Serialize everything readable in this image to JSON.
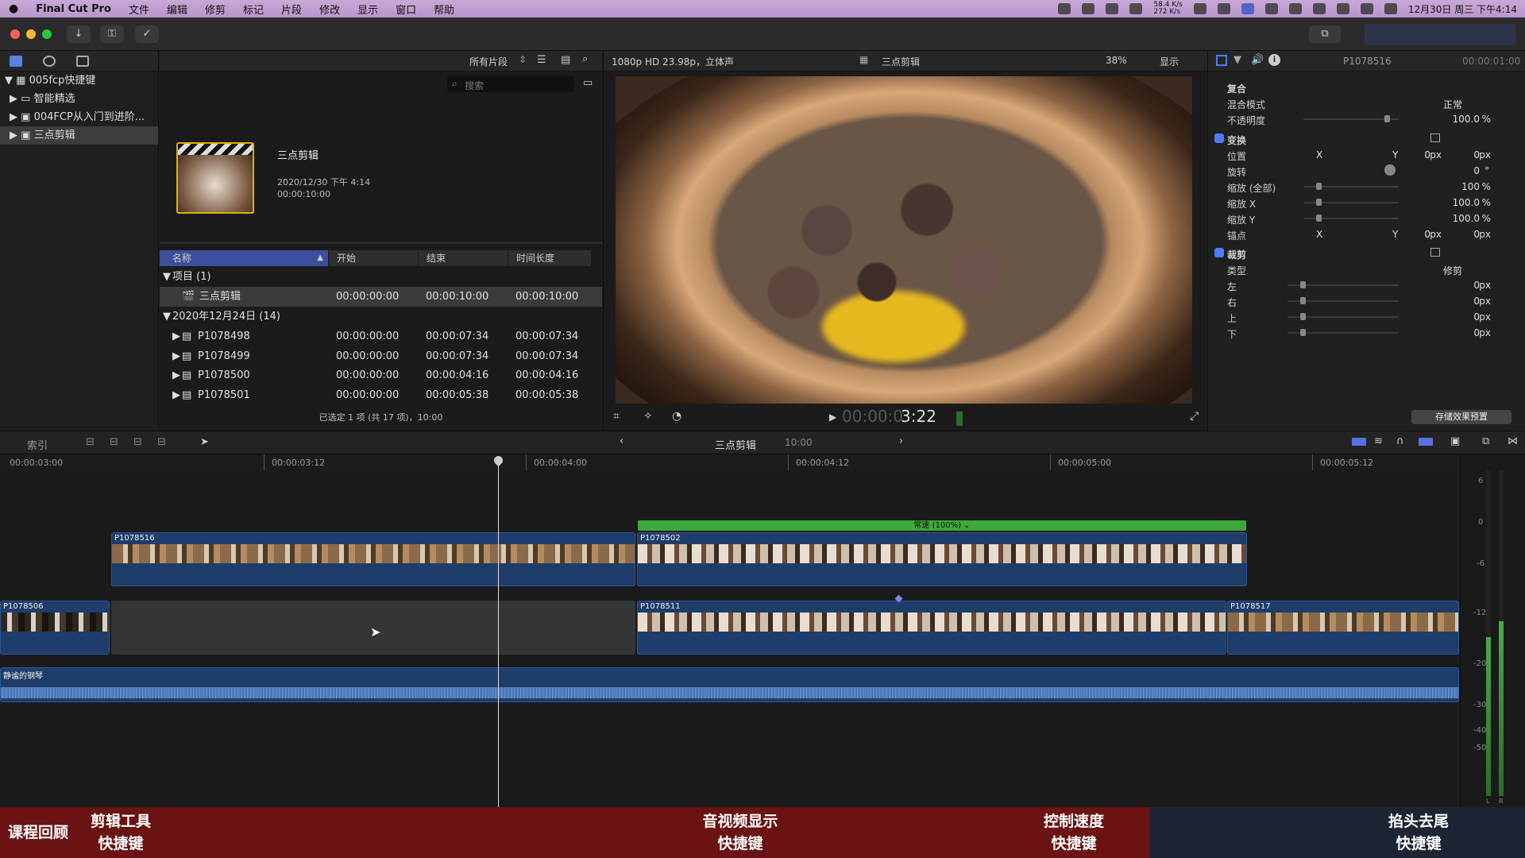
{
  "menubar": {
    "apple": "",
    "app_name": "Final Cut Pro",
    "items": [
      "文件",
      "编辑",
      "修剪",
      "标记",
      "片段",
      "修改",
      "显示",
      "窗口",
      "帮助"
    ],
    "net_up": "58.4 K/s",
    "net_down": "272 K/s",
    "clock": "12月30日 周三 下午4:14"
  },
  "library": {
    "rows": [
      {
        "label": "005fcp快捷键",
        "level": 0,
        "arrow": "▼",
        "selected": false
      },
      {
        "label": "智能精选",
        "level": 1,
        "arrow": "▶",
        "selected": false
      },
      {
        "label": "004FCP从入门到进阶...",
        "level": 1,
        "arrow": "▶",
        "selected": false
      },
      {
        "label": "三点剪辑",
        "level": 1,
        "arrow": "▶",
        "selected": true
      }
    ]
  },
  "browser": {
    "filter": "所有片段",
    "search_placeholder": "搜索",
    "project": {
      "title": "三点剪辑",
      "date": "2020/12/30 下午 4:14",
      "duration": "00:00:10:00"
    },
    "columns": [
      "名称",
      "开始",
      "结束",
      "时间长度"
    ],
    "group1": "项目 (1)",
    "project_row": {
      "name": "三点剪辑",
      "start": "00:00:00:00",
      "end": "00:00:10:00",
      "dur": "00:00:10:00"
    },
    "group2": "2020年12月24日 (14)",
    "clips": [
      {
        "name": "P1078498",
        "start": "00:00:00:00",
        "end": "00:00:07:34",
        "dur": "00:00:07:34"
      },
      {
        "name": "P1078499",
        "start": "00:00:00:00",
        "end": "00:00:07:34",
        "dur": "00:00:07:34"
      },
      {
        "name": "P1078500",
        "start": "00:00:00:00",
        "end": "00:00:04:16",
        "dur": "00:00:04:16"
      },
      {
        "name": "P1078501",
        "start": "00:00:00:00",
        "end": "00:00:05:38",
        "dur": "00:00:05:38"
      }
    ],
    "status": "已选定 1 项 (共 17 项)，10:00"
  },
  "viewer": {
    "format": "1080p HD 23.98p，立体声",
    "title": "三点剪辑",
    "zoom": "38%",
    "display": "显示",
    "timecode_dim": "00:00:0",
    "timecode": "3:22"
  },
  "inspector": {
    "clip_name": "P1078516",
    "clip_time": "00:00:01:00",
    "composite": "复合",
    "blend_label": "混合模式",
    "blend_value": "正常",
    "opacity_label": "不透明度",
    "opacity_value": "100.0",
    "opacity_unit": "%",
    "transform": "变换",
    "position_label": "位置",
    "x": "X",
    "y": "Y",
    "pos_x": "0",
    "pos_y": "0",
    "px": "px",
    "rotation_label": "旋转",
    "rotation_value": "0",
    "deg": "°",
    "scale_all_label": "缩放 (全部)",
    "scale_all_value": "100",
    "scale_x_label": "缩放 X",
    "scale_x_value": "100.0",
    "scale_y_label": "缩放 Y",
    "scale_y_value": "100.0",
    "anchor_label": "锚点",
    "anchor_x": "0",
    "anchor_y": "0",
    "crop": "裁剪",
    "type_label": "类型",
    "type_value": "修剪",
    "left_label": "左",
    "right_label": "右",
    "top_label": "上",
    "bottom_label": "下",
    "crop_left": "0",
    "crop_right": "0",
    "crop_top": "0",
    "crop_bottom": "0",
    "save_preset": "存储效果预置"
  },
  "timeline": {
    "index": "索引",
    "project_name": "三点剪辑",
    "project_duration": "10:00",
    "ruler": [
      "00:00:03:00",
      "00:00:03:12",
      "00:00:04:00",
      "00:00:04:12",
      "00:00:05:00",
      "00:00:05:12"
    ],
    "speed_label": "常速 (100%)",
    "clips": {
      "c1": "P1078516",
      "c2": "P1078502",
      "c3": "P1078506",
      "c4": "P1078511",
      "c5": "P1078517"
    },
    "audio_label": "静谧的钢琴",
    "meter_scale": [
      "6",
      "0",
      "-6",
      "-12",
      "-20",
      "-30",
      "-40",
      "-50"
    ],
    "meter_lr": [
      "L",
      "R"
    ]
  },
  "captions": {
    "c1": "课程回顾",
    "c2a": "剪辑工具",
    "c2b": "快捷键",
    "c3a": "音视频显示",
    "c3b": "快捷键",
    "c4a": "控制速度",
    "c4b": "快捷键",
    "c5a": "掐头去尾",
    "c5b": "快捷键"
  },
  "colors": {
    "accent": "#4a7dff",
    "clip_blue": "#1f3d6b",
    "speed_green": "#3fa83a",
    "caption_bg": "#6b1212"
  }
}
